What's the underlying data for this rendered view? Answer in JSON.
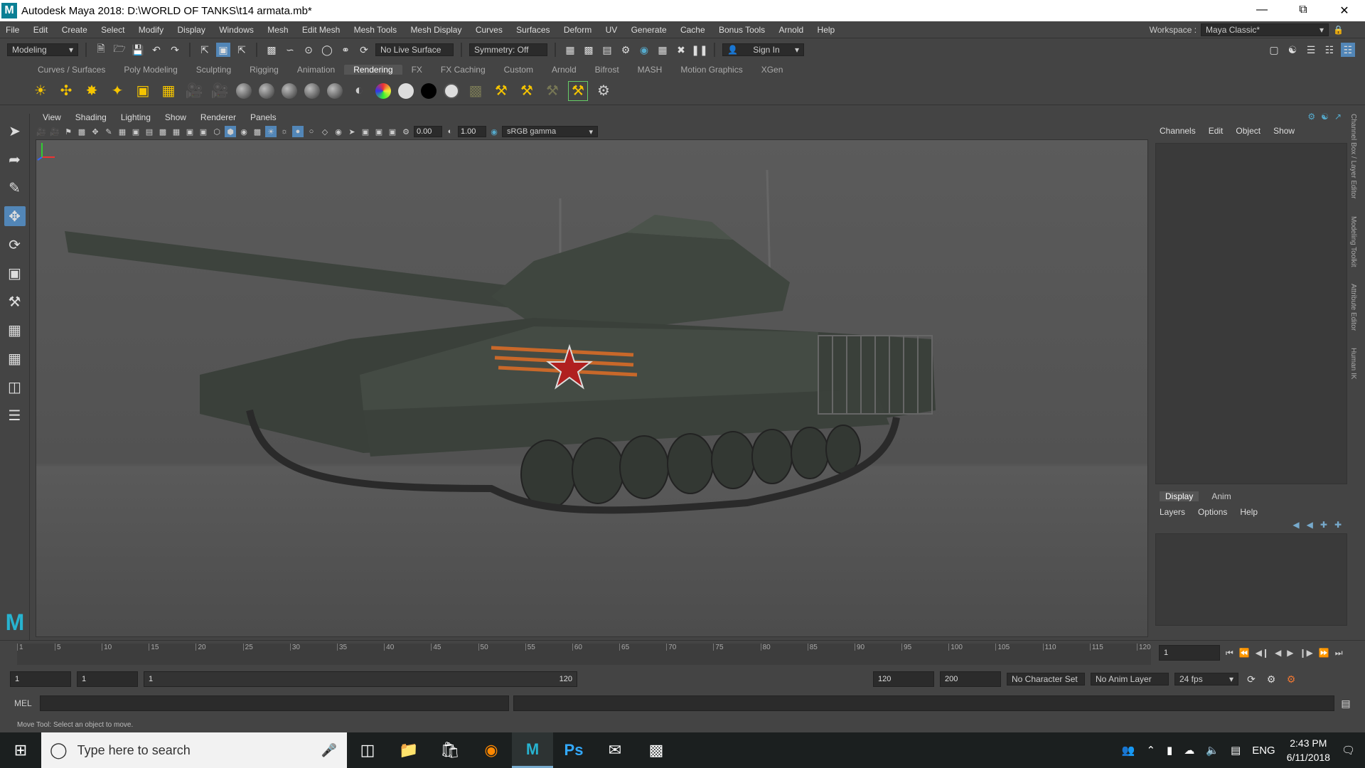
{
  "window": {
    "title": "Autodesk Maya 2018: D:\\WORLD OF TANKS\\t14 armata.mb*",
    "logo_letter": "M"
  },
  "menubar": {
    "items": [
      "File",
      "Edit",
      "Create",
      "Select",
      "Modify",
      "Display",
      "Windows",
      "Mesh",
      "Edit Mesh",
      "Mesh Tools",
      "Mesh Display",
      "Curves",
      "Surfaces",
      "Deform",
      "UV",
      "Generate",
      "Cache",
      "Bonus Tools",
      "Arnold",
      "Help"
    ],
    "workspace_label": "Workspace :",
    "workspace_value": "Maya Classic*"
  },
  "statusline": {
    "mode": "Modeling",
    "live_surface": "No Live Surface",
    "symmetry": "Symmetry: Off",
    "sign_in": "Sign In"
  },
  "shelf": {
    "tabs": [
      "Curves / Surfaces",
      "Poly Modeling",
      "Sculpting",
      "Rigging",
      "Animation",
      "Rendering",
      "FX",
      "FX Caching",
      "Custom",
      "Arnold",
      "Bifrost",
      "MASH",
      "Motion Graphics",
      "XGen"
    ],
    "active_tab": "Rendering"
  },
  "panel": {
    "menus": [
      "View",
      "Shading",
      "Lighting",
      "Show",
      "Renderer",
      "Panels"
    ],
    "exposure": "0.00",
    "gamma": "1.00",
    "color_space": "sRGB gamma"
  },
  "channelbox": {
    "menus": [
      "Channels",
      "Edit",
      "Object",
      "Show"
    ],
    "layer_tabs": [
      "Display",
      "Anim"
    ],
    "layer_menus": [
      "Layers",
      "Options",
      "Help"
    ]
  },
  "sidetabs": [
    "Channel Box / Layer Editor",
    "Modeling Toolkit",
    "Attribute Editor",
    "Human IK"
  ],
  "timeslider": {
    "ticks": [
      1,
      5,
      10,
      15,
      20,
      25,
      30,
      35,
      40,
      45,
      50,
      55,
      60,
      65,
      70,
      75,
      80,
      85,
      90,
      95,
      100,
      105,
      110,
      115,
      120
    ],
    "current_frame": "1"
  },
  "range": {
    "start": "1",
    "playback_start": "1",
    "slider_start": "1",
    "slider_end": "120",
    "playback_end": "120",
    "end": "200",
    "character_set": "No Character Set",
    "anim_layer": "No Anim Layer",
    "fps": "24 fps"
  },
  "commandline": {
    "label": "MEL"
  },
  "helpline": {
    "text": "Move Tool: Select an object to move."
  },
  "taskbar": {
    "search_placeholder": "Type here to search",
    "lang": "ENG",
    "time": "2:43 PM",
    "date": "6/11/2018"
  }
}
